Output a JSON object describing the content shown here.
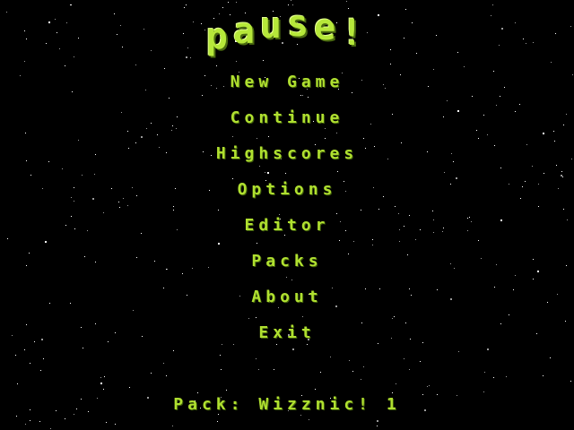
{
  "title": "Pause!",
  "menu": {
    "items": [
      {
        "id": "new-game",
        "label": "New Game"
      },
      {
        "id": "continue",
        "label": "Continue"
      },
      {
        "id": "highscores",
        "label": "Highscores"
      },
      {
        "id": "options",
        "label": "Options"
      },
      {
        "id": "editor",
        "label": "Editor"
      },
      {
        "id": "packs",
        "label": "Packs"
      },
      {
        "id": "about",
        "label": "About"
      },
      {
        "id": "exit",
        "label": "Exit"
      }
    ]
  },
  "footer": {
    "pack_label": "Pack:",
    "pack_name": "Wizznic! 1"
  },
  "colors": {
    "background": "#000000",
    "text": "#b0e030",
    "stars": "#ffffff"
  }
}
